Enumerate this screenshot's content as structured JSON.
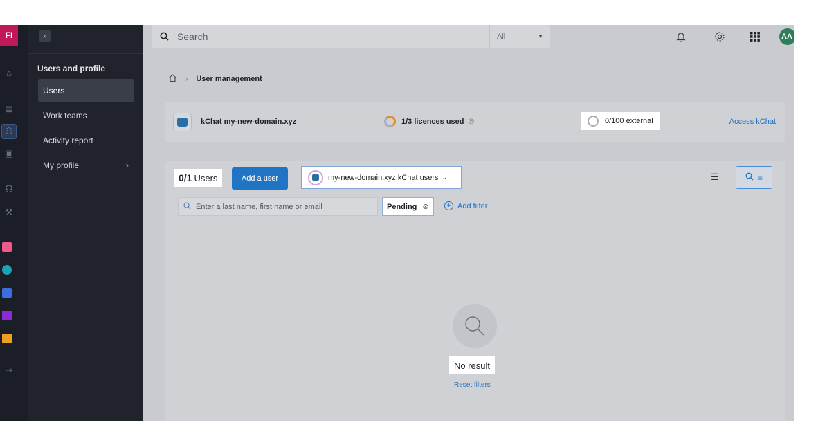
{
  "rail": {
    "avatar": "FI",
    "colors": {
      "avatar": "#c2185b",
      "accent": "#1f75c4"
    }
  },
  "sidebar": {
    "section_title": "Users and profile",
    "items": [
      {
        "label": "Users",
        "active": true
      },
      {
        "label": "Work teams"
      },
      {
        "label": "Activity report"
      },
      {
        "label": "My profile"
      }
    ]
  },
  "topbar": {
    "search_placeholder": "Search",
    "search_scope": "All",
    "user_initials": "AA"
  },
  "breadcrumb": {
    "current": "User management"
  },
  "product_card": {
    "name": "kChat my-new-domain.xyz",
    "licences": "1/3 licences used",
    "licences_used": 1,
    "licences_total": 3,
    "external": "0/100 external",
    "access_link": "Access kChat"
  },
  "users_panel": {
    "count": "0/1",
    "count_label": "Users",
    "add_user": "Add a user",
    "group_filter": "my-new-domain.xyz kChat users",
    "name_search_placeholder": "Enter a last name, first name or email",
    "active_filter": "Pending",
    "add_filter": "Add filter",
    "empty_title": "No result",
    "reset_filters": "Reset filters"
  }
}
